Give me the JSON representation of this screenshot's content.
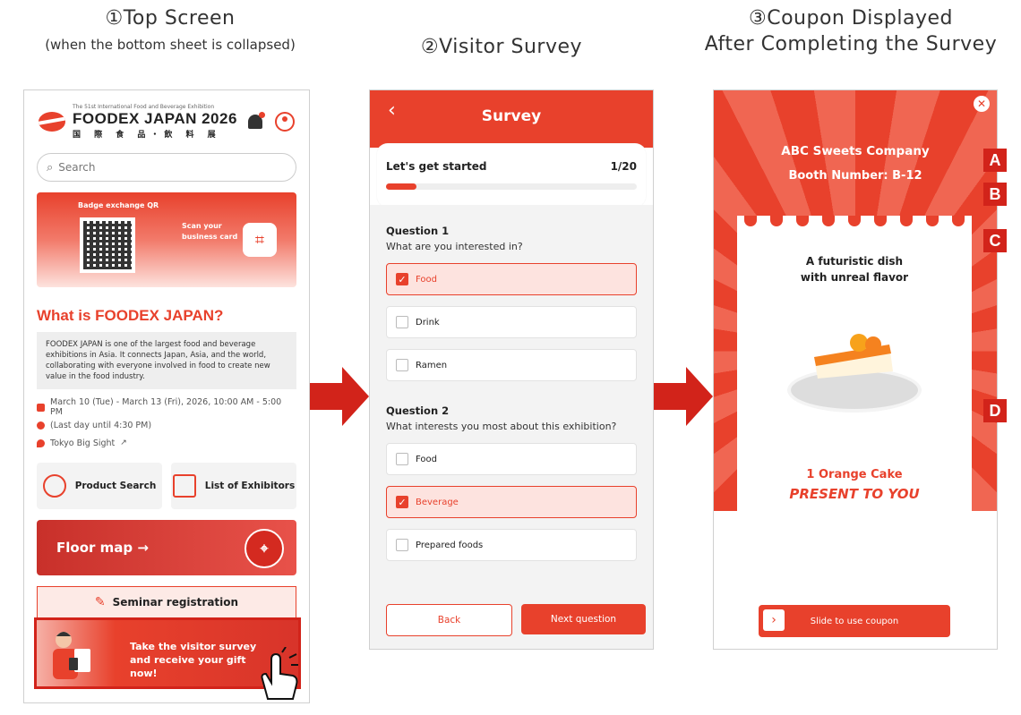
{
  "captions": {
    "screen1_title": "①Top Screen",
    "screen1_sub": "(when the bottom sheet is collapsed)",
    "screen2_title": "②Visitor Survey",
    "screen3_title_line1": "③Coupon Displayed",
    "screen3_title_line2": "After Completing the Survey"
  },
  "screen1": {
    "logo_small": "The 51st International Food and Beverage Exhibition",
    "logo_main": "FOODEX JAPAN 2026",
    "logo_jp": "国 際 食 品・飲 料 展",
    "search_placeholder": "Search",
    "badge_label": "Badge exchange QR",
    "scan_label": "Scan your business card",
    "what_heading": "What is FOODEX JAPAN?",
    "description": "FOODEX JAPAN is one of the largest food and beverage exhibitions in Asia. It connects Japan, Asia, and the world, collaborating with everyone involved in food to create new value in the food industry.",
    "date_line": "March 10 (Tue) - March 13 (Fri), 2026, 10:00 AM - 5:00 PM",
    "last_day": "(Last day until 4:30 PM)",
    "venue": "Tokyo Big Sight",
    "tile_product": "Product Search",
    "tile_exhibitors": "List of Exhibitors",
    "floor_map": "Floor map →",
    "seminar": "Seminar registration",
    "survey_banner": "Take the visitor survey and receive your gift now!"
  },
  "screen2": {
    "title": "Survey",
    "back_glyph": "‹",
    "progress_label": "Let's get started",
    "progress_count": "1/20",
    "progress_fraction": 0.12,
    "q1_head": "Question 1",
    "q1_text": "What are you interested in?",
    "q1_options": [
      {
        "label": "Food",
        "selected": true
      },
      {
        "label": "Drink",
        "selected": false
      },
      {
        "label": "Ramen",
        "selected": false
      }
    ],
    "q2_head": "Question 2",
    "q2_text": "What interests you most about this exhibition?",
    "q2_options": [
      {
        "label": "Food",
        "selected": false
      },
      {
        "label": "Beverage",
        "selected": true
      },
      {
        "label": "Prepared foods",
        "selected": false
      }
    ],
    "back_label": "Back",
    "next_label": "Next question"
  },
  "screen3": {
    "company": "ABC Sweets Company",
    "booth": "Booth Number: B-12",
    "dish_line1": "A futuristic dish",
    "dish_line2": "with unreal flavor",
    "prize": "1 Orange Cake",
    "present": "PRESENT TO YOU",
    "slide_label": "Slide to use coupon",
    "markers": [
      "A",
      "B",
      "C",
      "D"
    ]
  },
  "colors": {
    "accent": "#e8412c",
    "marker": "#d2231a"
  }
}
